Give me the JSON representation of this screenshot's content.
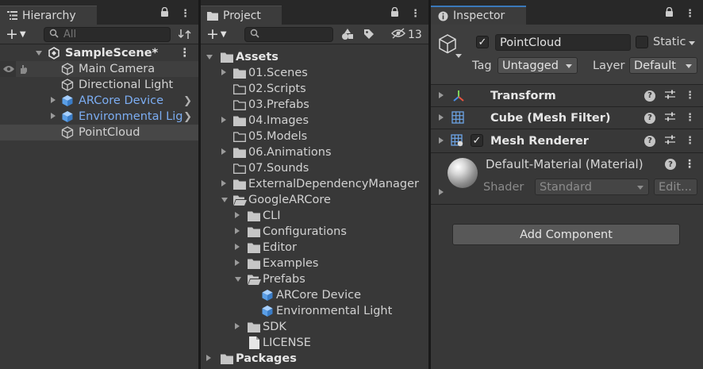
{
  "hierarchy": {
    "tab_label": "Hierarchy",
    "search_placeholder": "All",
    "scene_name": "SampleScene*",
    "items": [
      {
        "label": "Main Camera"
      },
      {
        "label": "Directional Light"
      },
      {
        "label": "ARCore Device"
      },
      {
        "label": "Environmental Lig"
      },
      {
        "label": "PointCloud"
      }
    ]
  },
  "project": {
    "tab_label": "Project",
    "hidden_count": "13",
    "tree": [
      {
        "label": "Assets"
      },
      {
        "label": "01.Scenes"
      },
      {
        "label": "02.Scripts"
      },
      {
        "label": "03.Prefabs"
      },
      {
        "label": "04.Images"
      },
      {
        "label": "05.Models"
      },
      {
        "label": "06.Animations"
      },
      {
        "label": "07.Sounds"
      },
      {
        "label": "ExternalDependencyManager"
      },
      {
        "label": "GoogleARCore"
      },
      {
        "label": "CLI"
      },
      {
        "label": "Configurations"
      },
      {
        "label": "Editor"
      },
      {
        "label": "Examples"
      },
      {
        "label": "Prefabs"
      },
      {
        "label": "ARCore Device"
      },
      {
        "label": "Environmental Light"
      },
      {
        "label": "SDK"
      },
      {
        "label": "LICENSE"
      },
      {
        "label": "Packages"
      }
    ]
  },
  "inspector": {
    "tab_label": "Inspector",
    "object_name": "PointCloud",
    "static_label": "Static",
    "tag_label": "Tag",
    "tag_value": "Untagged",
    "layer_label": "Layer",
    "layer_value": "Default",
    "components": [
      {
        "label": "Transform"
      },
      {
        "label": "Cube (Mesh Filter)"
      },
      {
        "label": "Mesh Renderer"
      }
    ],
    "material_name": "Default-Material (Material)",
    "shader_label": "Shader",
    "shader_value": "Standard",
    "edit_label": "Edit...",
    "add_component_label": "Add Component"
  },
  "colors": {
    "panel": "#383838",
    "prefab_blue": "#7cadf2",
    "tab_accent": "#3a79bb"
  }
}
